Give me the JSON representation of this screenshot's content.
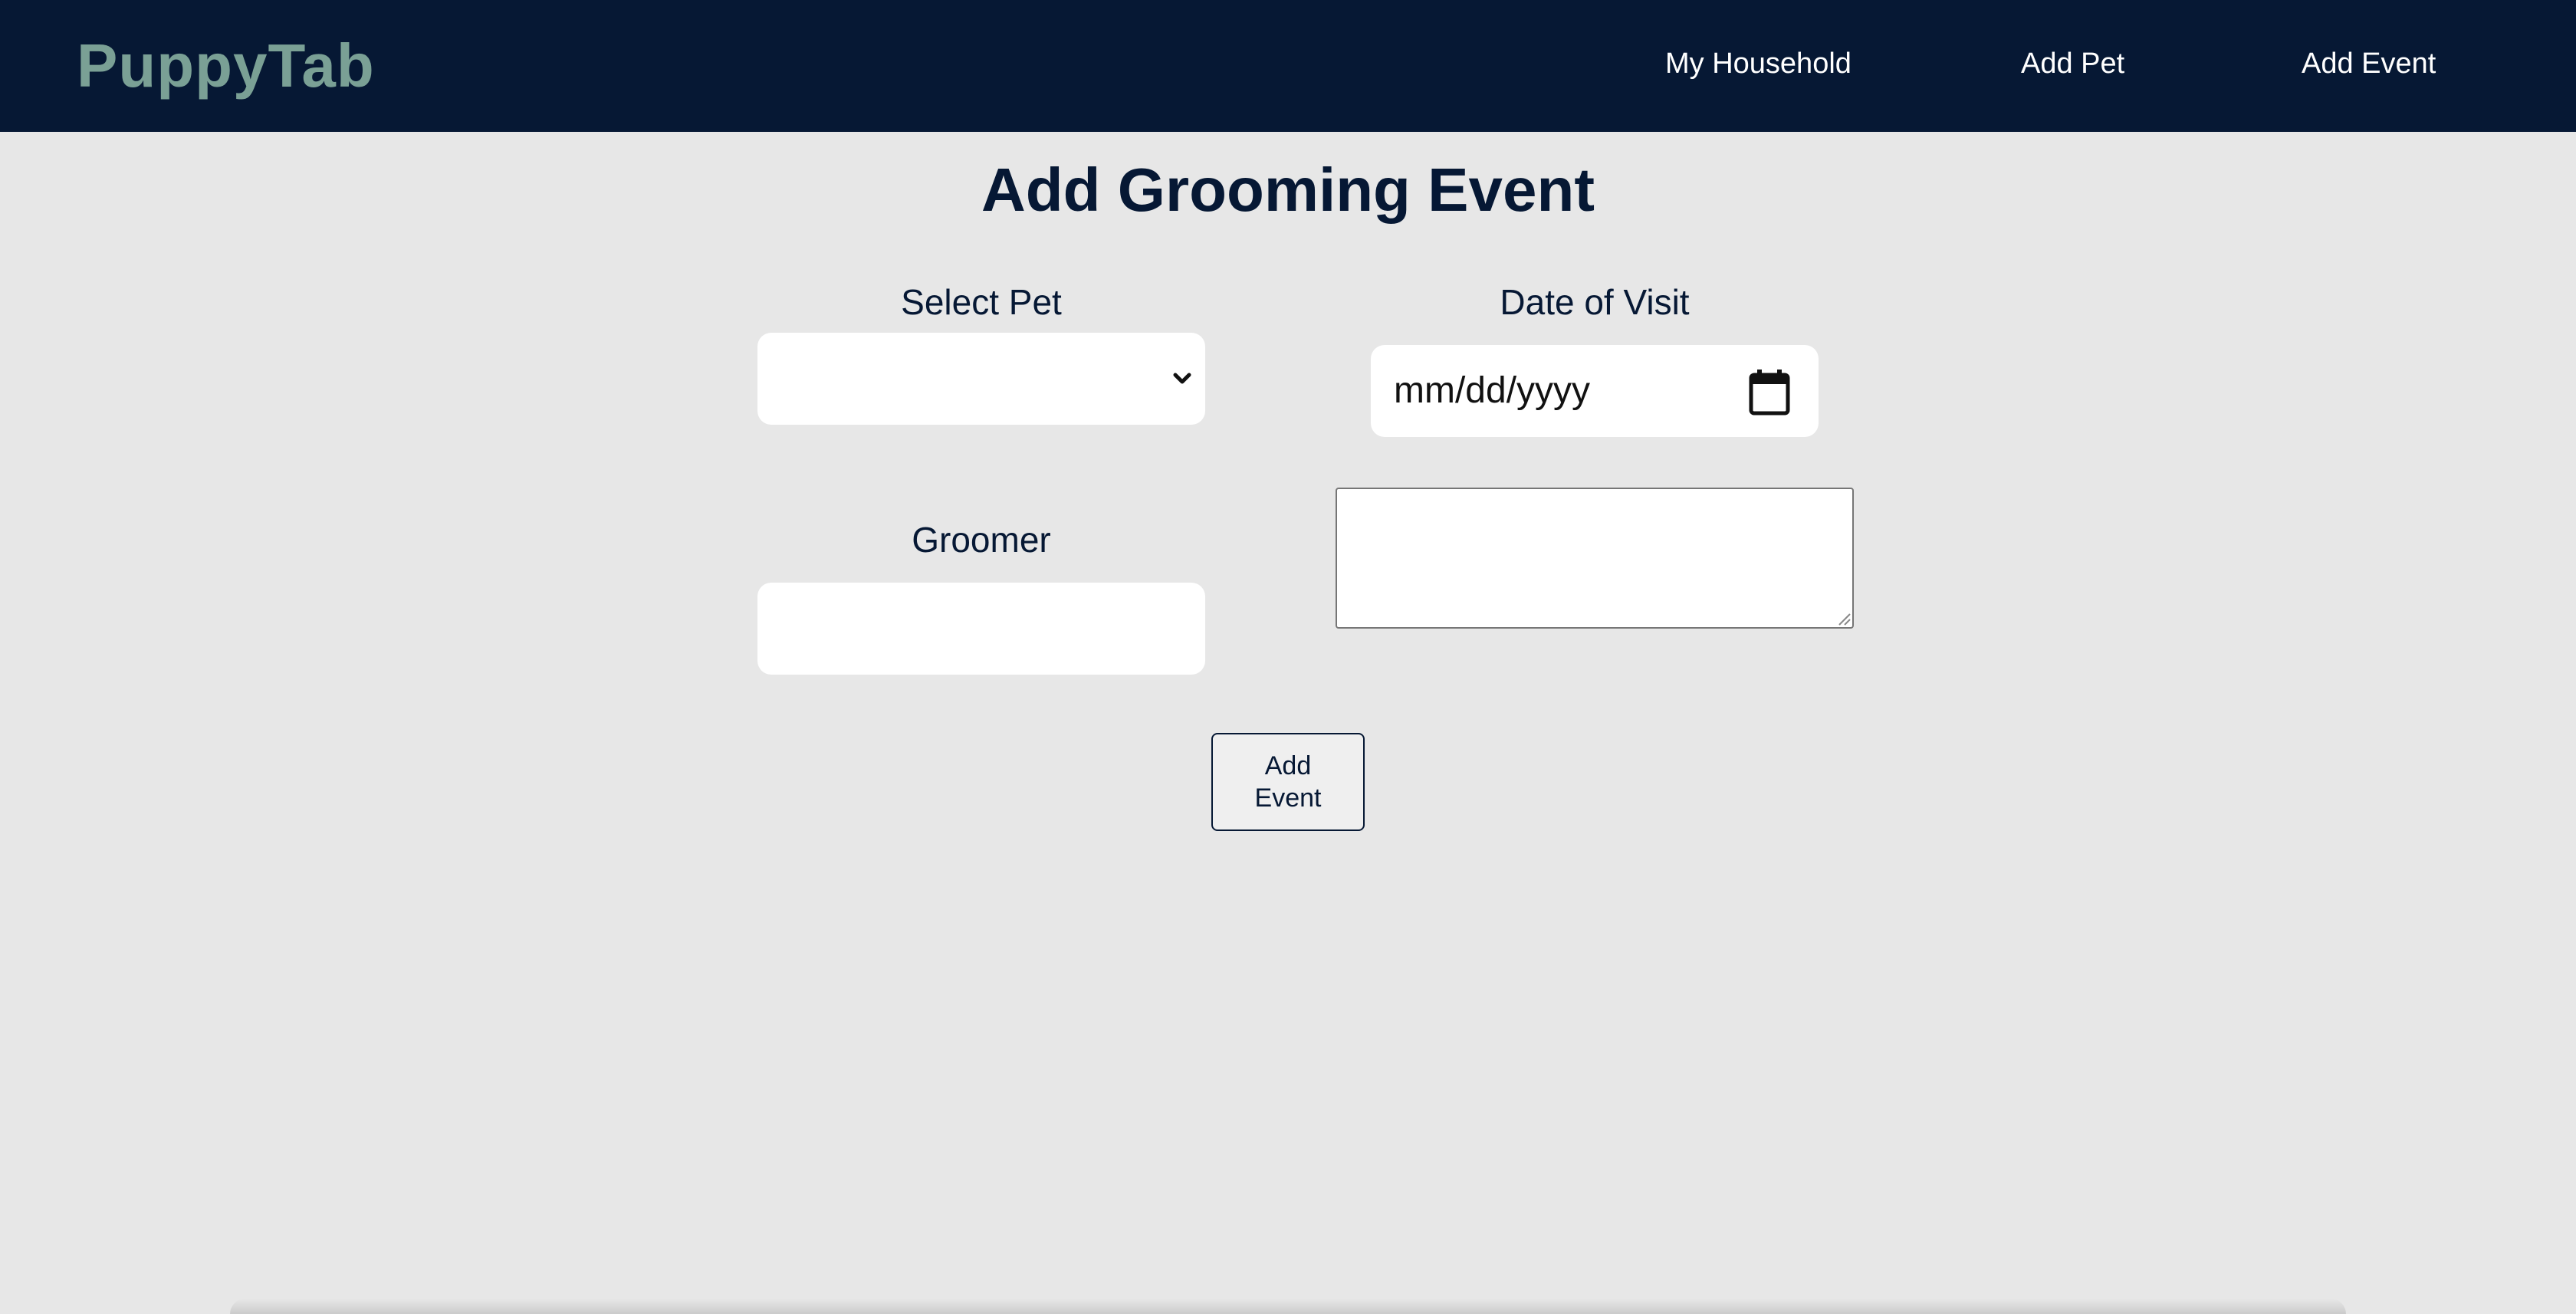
{
  "navbar": {
    "brand": "PuppyTab",
    "links": [
      "My Household",
      "Add Pet",
      "Add Event"
    ]
  },
  "page": {
    "title": "Add Grooming Event"
  },
  "form": {
    "select_pet_label": "Select Pet",
    "select_pet_value": "",
    "date_label": "Date of Visit",
    "date_placeholder": "mm/dd/yyyy",
    "groomer_label": "Groomer",
    "groomer_value": "",
    "notes_value": "",
    "submit_label_line1": "Add",
    "submit_label_line2": "Event"
  },
  "icons": {
    "select": "chevron-down-icon",
    "date": "calendar-icon"
  },
  "colors": {
    "navbar_bg": "#061834",
    "brand": "#7aa095",
    "page_bg": "#e7e7e7",
    "text_dark": "#061834"
  }
}
